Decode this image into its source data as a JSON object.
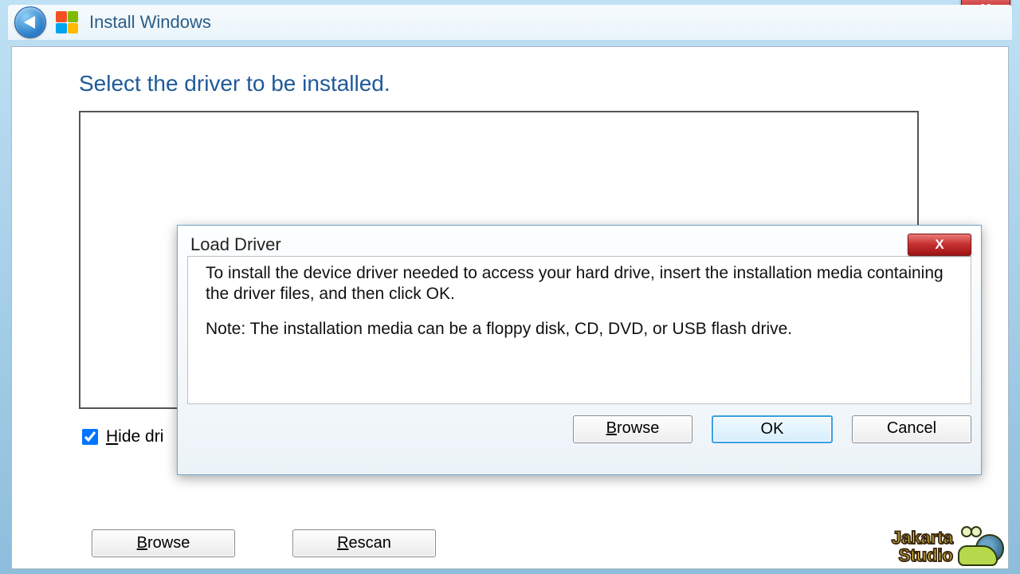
{
  "window": {
    "title": "Install Windows",
    "close_x": "X"
  },
  "main": {
    "heading": "Select the driver to be installed.",
    "hide_label": "Hide dri",
    "hide_checked": true,
    "browse_btn": "Browse",
    "rescan_btn": "Rescan"
  },
  "dialog": {
    "title": "Load Driver",
    "close_x": "X",
    "msg1": "To install the device driver needed to access your hard drive, insert the installation media containing the driver files, and then click OK.",
    "msg2": "Note: The installation media can be a floppy disk, CD, DVD, or USB flash drive.",
    "browse": "Browse",
    "ok": "OK",
    "cancel": "Cancel"
  },
  "watermark": {
    "line1": "Jakarta",
    "line2": "Studio"
  }
}
